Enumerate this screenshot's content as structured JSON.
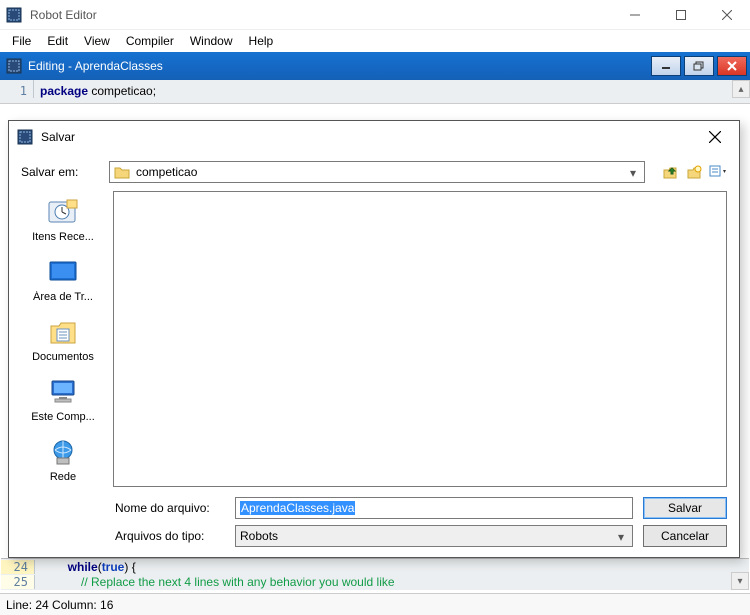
{
  "app": {
    "title": "Robot Editor"
  },
  "menubar": {
    "items": [
      "File",
      "Edit",
      "View",
      "Compiler",
      "Window",
      "Help"
    ]
  },
  "child": {
    "title": "Editing - AprendaClasses"
  },
  "editor": {
    "line1_no": "1",
    "line1_kw": "package",
    "line1_rest": " competicao;"
  },
  "bottom": {
    "line24_no": "24",
    "line24_indent": "        ",
    "line24_kw": "while",
    "line24_paren_open": "(",
    "line24_bool": "true",
    "line24_paren_rest": ") {",
    "line25_no": "25",
    "line25_indent": "            ",
    "line25_comment": "// Replace the next 4 lines with any behavior you would like"
  },
  "status": {
    "text": "Line: 24 Column: 16"
  },
  "dialog": {
    "title": "Salvar",
    "look_in_label": "Salvar em:",
    "look_in_value": "competicao",
    "places": {
      "recent": "Itens Rece...",
      "desktop": "Área de Tr...",
      "documents": "Documentos",
      "computer": "Este Comp...",
      "network": "Rede"
    },
    "filename_label": "Nome do arquivo:",
    "filename_value": "AprendaClasses.java",
    "filetype_label": "Arquivos do tipo:",
    "filetype_value": "Robots",
    "save_btn": "Salvar",
    "cancel_btn": "Cancelar"
  }
}
